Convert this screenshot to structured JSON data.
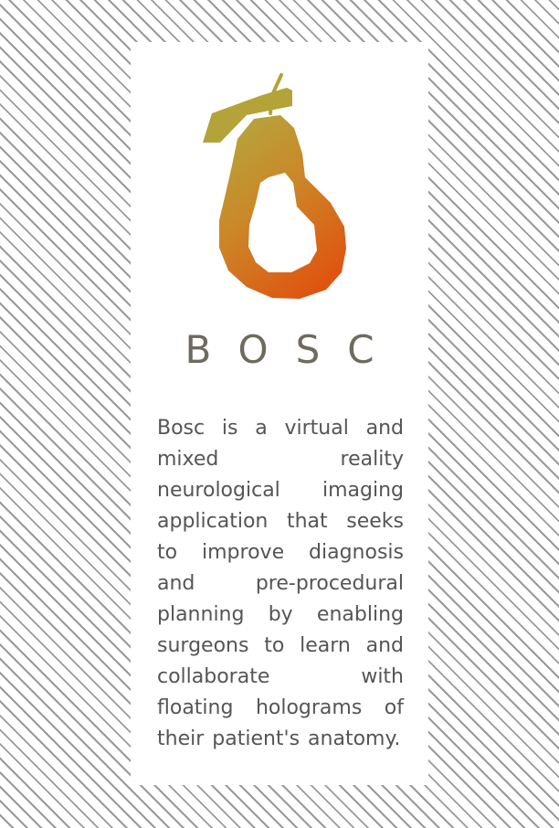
{
  "brand": {
    "name": "BOSC",
    "colors": {
      "leaf": "#b3a338",
      "stem": "#b3a338",
      "pear_top": "#b7a23a",
      "pear_bottom": "#df5a14",
      "text": "#6e6a5f"
    },
    "icon": "pear-logo-icon"
  },
  "description": "Bosc is a virtual and mixed reality neurological imaging application that seeks to improve diagnosis and pre-procedural planning by enabling surgeons to learn and collaborate with floating holograms of their patient's anatomy."
}
